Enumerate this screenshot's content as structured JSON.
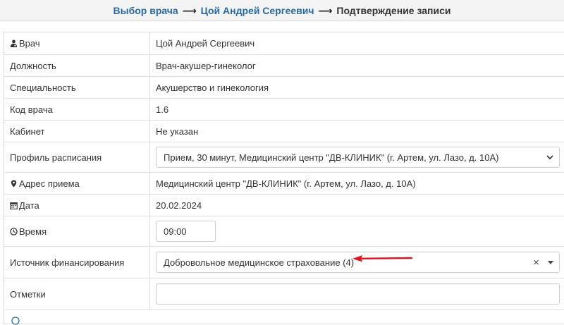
{
  "breadcrumb": {
    "step1": "Выбор врача",
    "arrow": "⟶",
    "step2": "Цой Андрей Сергеевич",
    "step3": "Подтверждение записи"
  },
  "rows": {
    "doctor": {
      "label": "Врач",
      "value": "Цой Андрей Сергеевич"
    },
    "position": {
      "label": "Должность",
      "value": "Врач-акушер-гинеколог"
    },
    "specialty": {
      "label": "Специальность",
      "value": "Акушерство и гинекология"
    },
    "doctor_code": {
      "label": "Код врача",
      "value": "1.6"
    },
    "office": {
      "label": "Кабинет",
      "value": "Не указан"
    },
    "schedule_profile": {
      "label": "Профиль расписания",
      "value": "Прием, 30 минут, Медицинский центр \"ДВ-КЛИНИК\" (г. Артем, ул. Лазо, д. 10А)"
    },
    "address": {
      "label": "Адрес приема",
      "value": "Медицинский центр \"ДВ-КЛИНИК\" (г. Артем, ул. Лазо, д. 10А)"
    },
    "date": {
      "label": "Дата",
      "value": "20.02.2024"
    },
    "time": {
      "label": "Время",
      "value": "09:00"
    },
    "funding": {
      "label": "Источник финансирования",
      "value": "Добровольное медицинское страхование (4)",
      "clear": "×"
    },
    "notes": {
      "label": "Отметки",
      "value": ""
    }
  },
  "colors": {
    "link": "#2a6ba5",
    "annotation_arrow": "#e0141e",
    "border": "#dddddd"
  },
  "icons": {
    "doctor": "user-md-icon",
    "address": "map-marker-icon",
    "date": "calendar-icon",
    "time": "clock-icon"
  }
}
